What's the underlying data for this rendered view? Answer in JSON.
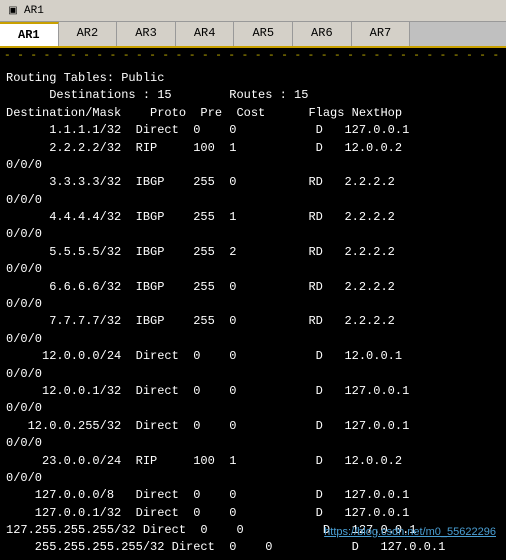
{
  "titleBar": {
    "icon": "▣",
    "title": "AR1"
  },
  "tabs": [
    {
      "label": "AR1",
      "active": true
    },
    {
      "label": "AR2",
      "active": false
    },
    {
      "label": "AR3",
      "active": false
    },
    {
      "label": "AR4",
      "active": false
    },
    {
      "label": "AR5",
      "active": false
    },
    {
      "label": "AR6",
      "active": false
    },
    {
      "label": "AR7",
      "active": false
    }
  ],
  "dashedLine": "- - - - - - - - - - - - - - - - - - - - - - - - - - - - - - - - - - - - - - -",
  "terminalLines": [
    {
      "text": "Routing Tables: Public",
      "class": ""
    },
    {
      "text": "      Destinations : 15        Routes : 15",
      "class": ""
    },
    {
      "text": "",
      "class": ""
    },
    {
      "text": "Destination/Mask    Proto  Pre  Cost      Flags NextHop",
      "class": ""
    },
    {
      "text": "",
      "class": ""
    },
    {
      "text": "      1.1.1.1/32  Direct  0    0           D   127.0.0.1",
      "class": ""
    },
    {
      "text": "      2.2.2.2/32  RIP     100  1           D   12.0.0.2",
      "class": ""
    },
    {
      "text": "0/0/0",
      "class": ""
    },
    {
      "text": "      3.3.3.3/32  IBGP    255  0          RD   2.2.2.2",
      "class": ""
    },
    {
      "text": "0/0/0",
      "class": ""
    },
    {
      "text": "      4.4.4.4/32  IBGP    255  1          RD   2.2.2.2",
      "class": ""
    },
    {
      "text": "0/0/0",
      "class": ""
    },
    {
      "text": "      5.5.5.5/32  IBGP    255  2          RD   2.2.2.2",
      "class": ""
    },
    {
      "text": "0/0/0",
      "class": ""
    },
    {
      "text": "      6.6.6.6/32  IBGP    255  0          RD   2.2.2.2",
      "class": ""
    },
    {
      "text": "0/0/0",
      "class": ""
    },
    {
      "text": "      7.7.7.7/32  IBGP    255  0          RD   2.2.2.2",
      "class": ""
    },
    {
      "text": "0/0/0",
      "class": ""
    },
    {
      "text": "     12.0.0.0/24  Direct  0    0           D   12.0.0.1",
      "class": ""
    },
    {
      "text": "0/0/0",
      "class": ""
    },
    {
      "text": "     12.0.0.1/32  Direct  0    0           D   127.0.0.1",
      "class": ""
    },
    {
      "text": "0/0/0",
      "class": ""
    },
    {
      "text": "   12.0.0.255/32  Direct  0    0           D   127.0.0.1",
      "class": ""
    },
    {
      "text": "0/0/0",
      "class": ""
    },
    {
      "text": "     23.0.0.0/24  RIP     100  1           D   12.0.0.2",
      "class": ""
    },
    {
      "text": "0/0/0",
      "class": ""
    },
    {
      "text": "    127.0.0.0/8   Direct  0    0           D   127.0.0.1",
      "class": ""
    },
    {
      "text": "    127.0.0.1/32  Direct  0    0           D   127.0.0.1",
      "class": ""
    },
    {
      "text": "127.255.255.255/32 Direct  0    0           D   127.0.0.1",
      "class": ""
    },
    {
      "text": "    255.255.255.255/32 Direct  0    0           D   127.0.0.1",
      "class": ""
    }
  ],
  "watermark": "https://blog.csdn.net/m0_55622296"
}
